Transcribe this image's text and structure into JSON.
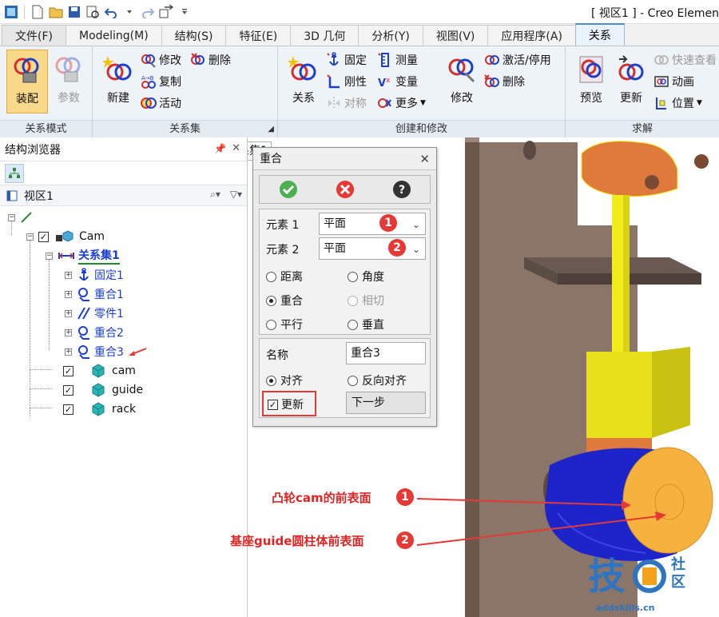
{
  "window": {
    "title": "[ 视区1 ] - Creo Elemen"
  },
  "tabs": [
    {
      "label": "文件(F)"
    },
    {
      "label": "Modeling(M)"
    },
    {
      "label": "结构(S)"
    },
    {
      "label": "特征(E)"
    },
    {
      "label": "3D 几何"
    },
    {
      "label": "分析(Y)"
    },
    {
      "label": "视图(V)"
    },
    {
      "label": "应用程序(A)"
    },
    {
      "label": "关系"
    }
  ],
  "ribbon": {
    "mode_group": {
      "label": "关系模式",
      "assembly": "装配",
      "parameters": "参数"
    },
    "set_group": {
      "label": "关系集",
      "new": "新建",
      "modify": "修改",
      "delete": "删除",
      "copy": "复制",
      "active": "活动",
      "relation_set_value": "关系集1"
    },
    "create_group": {
      "label": "创建和修改",
      "relation": "关系",
      "fixed": "固定",
      "rigid": "刚性",
      "symmetry": "对称",
      "measure": "测量",
      "variable": "变量",
      "more": "更多",
      "modify": "修改",
      "activate": "激活/停用",
      "delete": "删除"
    },
    "solve_group": {
      "label": "求解",
      "preview": "预览",
      "update": "更新",
      "quick_check": "快速查看",
      "animation": "动画",
      "position": "位置"
    }
  },
  "browser": {
    "title": "结构浏览器",
    "view": "视区1",
    "tree": {
      "cam": "Cam",
      "relation_set": "关系集1",
      "items": [
        "固定1",
        "重合1",
        "零件1",
        "重合2",
        "重合3"
      ],
      "parts": [
        "cam",
        "guide",
        "rack"
      ]
    }
  },
  "dialog": {
    "title": "重合",
    "element1_label": "元素 1",
    "element1_value": "平面",
    "element2_label": "元素 2",
    "element2_value": "平面",
    "types": {
      "distance": "距离",
      "angle": "角度",
      "coincident": "重合",
      "tangent": "相切",
      "parallel": "平行",
      "perpendicular": "垂直"
    },
    "name_label": "名称",
    "name_value": "重合3",
    "align": "对齐",
    "reverse_align": "反向对齐",
    "update": "更新",
    "next": "下一步"
  },
  "annotations": {
    "badge1": "1",
    "badge2": "2",
    "face1": "凸轮cam的前表面",
    "face2": "基座guide圆柱体前表面"
  },
  "watermark": {
    "mark": "技",
    "mark_side": "社区",
    "url": "addskills.cn"
  },
  "colors": {
    "accent_red": "#e53935",
    "tree_blue": "#1c3fcc",
    "active_tab": "#eaf3fb",
    "model_yellow": "#f2ec1c",
    "model_blue": "#1d24c9",
    "model_orange": "#f6b13e",
    "model_brown": "#8b7468"
  }
}
